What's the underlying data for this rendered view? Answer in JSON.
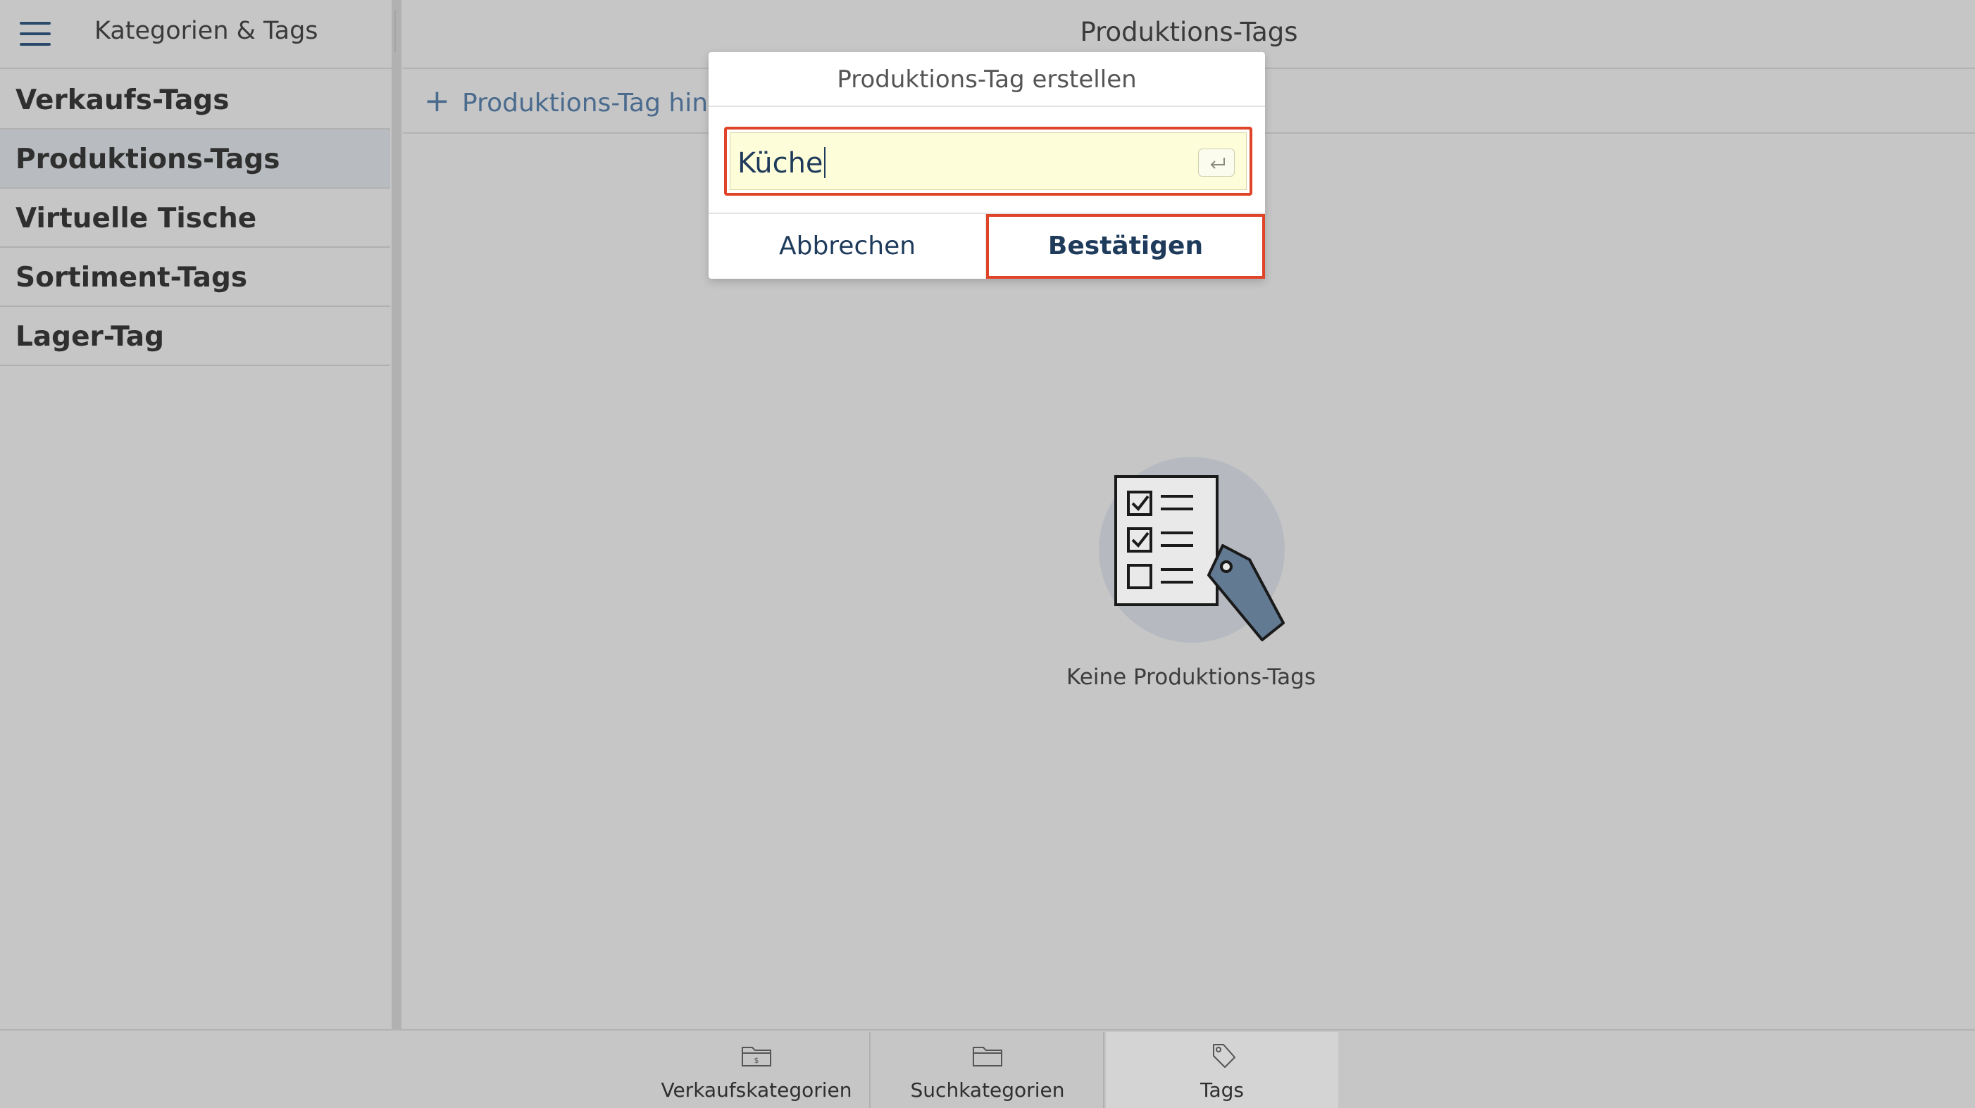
{
  "left_panel": {
    "title": "Kategorien & Tags",
    "menu_icon": "hamburger-menu-icon",
    "items": [
      {
        "label": "Verkaufs-Tags",
        "active": false
      },
      {
        "label": "Produktions-Tags",
        "active": true
      },
      {
        "label": "Virtuelle Tische",
        "active": false
      },
      {
        "label": "Sortiment-Tags",
        "active": false
      },
      {
        "label": "Lager-Tag",
        "active": false
      }
    ]
  },
  "main": {
    "title": "Produktions-Tags",
    "add_button": {
      "icon": "plus-icon",
      "label": "Produktions-Tag hinzu"
    },
    "empty_state": {
      "icon": "checklist-tag-illustration",
      "text": "Keine Produktions-Tags"
    }
  },
  "dialog": {
    "title": "Produktions-Tag erstellen",
    "input_value": "Küche",
    "enter_icon": "return-key-icon",
    "cancel_label": "Abbrechen",
    "confirm_label": "Bestätigen"
  },
  "bottom_tabs": [
    {
      "label": "Verkaufskategorien",
      "icon": "folder-dollar-icon"
    },
    {
      "label": "Suchkategorien",
      "icon": "folder-icon"
    },
    {
      "label": "Tags",
      "icon": "tag-icon",
      "active": true
    }
  ],
  "colors": {
    "accent": "#4a6b8e",
    "highlight_border": "#e04428",
    "input_background": "#fefdd9",
    "background": "#c6c6c6"
  }
}
